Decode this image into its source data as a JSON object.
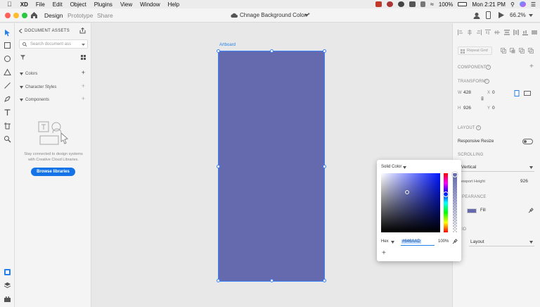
{
  "menubar": {
    "app_name": "XD",
    "items": [
      "File",
      "Edit",
      "Object",
      "Plugins",
      "View",
      "Window",
      "Help"
    ],
    "battery": "100%",
    "clock": "Mon 2:21 PM"
  },
  "titlebar": {
    "tabs": [
      "Design",
      "Prototype",
      "Share"
    ],
    "active_tab": "Design",
    "doc_title": "Chnage Background Color *",
    "zoom": "66.2%"
  },
  "assets": {
    "header": "DOCUMENT ASSETS",
    "search_placeholder": "Search document ass",
    "sections": [
      "Colors",
      "Character Styles",
      "Components"
    ],
    "empty_text_line1": "Stay connected to design systems",
    "empty_text_line2": "with Creative Cloud Libraries.",
    "browse_button": "Browse libraries"
  },
  "canvas": {
    "artboard_label": "Artboard",
    "artboard_fill": "#646AAD"
  },
  "props": {
    "repeat_grid": "Repeat Grid",
    "component_label": "COMPONENT",
    "transform_label": "TRANSFORM",
    "w_label": "W",
    "w_value": "428",
    "h_label": "H",
    "h_value": "926",
    "x_label": "X",
    "x_value": "0",
    "y_label": "Y",
    "y_value": "0",
    "layout_label": "LAYOUT",
    "responsive_resize": "Responsive Resize",
    "scrolling_label": "SCROLLING",
    "scrolling_value": "Vertical",
    "viewport_label": "ewport Height",
    "viewport_value": "926",
    "appearance_label": "PEARANCE",
    "fill_label": "Fill",
    "grid_label": "ID",
    "grid_value": "Layout"
  },
  "picker": {
    "mode": "Solid Color",
    "format": "Hex",
    "hex": "#646AAD",
    "opacity": "100%",
    "add": "+"
  }
}
